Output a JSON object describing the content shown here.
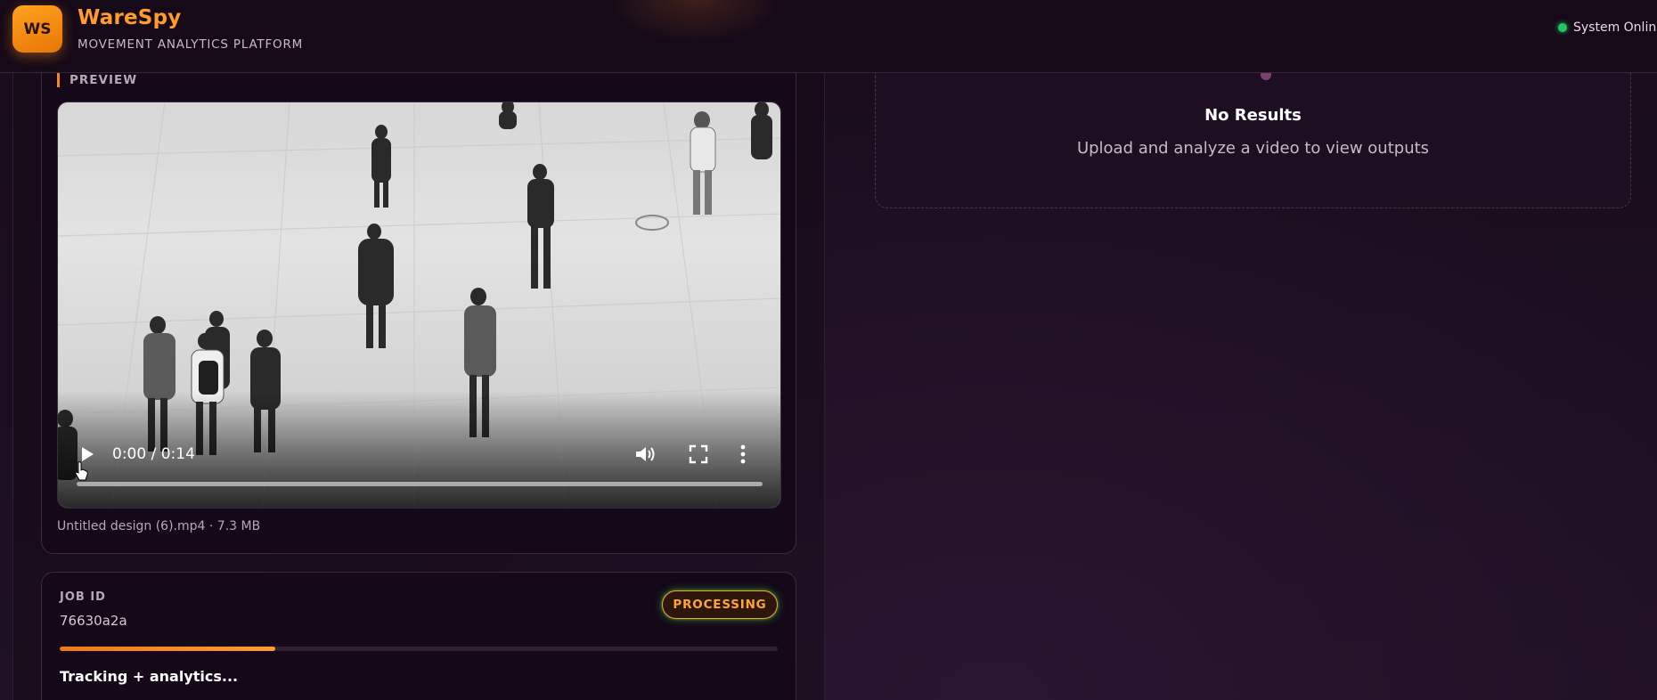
{
  "header": {
    "logo_text": "WS",
    "brand_name": "WareSpy",
    "brand_subtitle": "MOVEMENT ANALYTICS PLATFORM",
    "status_text": "System Online",
    "status_color": "#22c55e",
    "accent_color": "#ff9c2a"
  },
  "preview": {
    "section_label": "PREVIEW",
    "video": {
      "time_display": "0:00 / 0:14",
      "progress": 0,
      "controls": [
        "play-icon",
        "volume-icon",
        "fullscreen-icon",
        "more-vert-icon"
      ]
    },
    "file_meta": "Untitled design (6).mp4 · 7.3 MB"
  },
  "job": {
    "label": "JOB ID",
    "id": "76630a2a",
    "status_badge": "PROCESSING",
    "progress_fraction": 0.3,
    "step_text": "Tracking + analytics..."
  },
  "results": {
    "title": "No Results",
    "subtitle": "Upload and analyze a video to view outputs"
  }
}
